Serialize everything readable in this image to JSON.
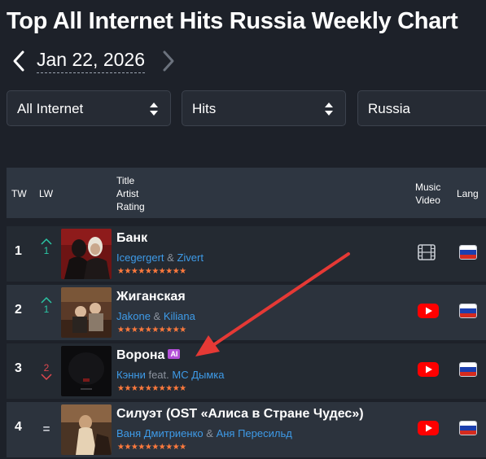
{
  "page": {
    "title": "Top All Internet Hits Russia Weekly Chart",
    "date": "Jan 22, 2026"
  },
  "filters": {
    "platform": "All Internet",
    "type": "Hits",
    "country": "Russia"
  },
  "table_header": {
    "tw": "TW",
    "lw": "LW",
    "title_lines": [
      "Title",
      "Artist",
      "Rating"
    ],
    "music_video_lines": [
      "Music",
      "Video"
    ],
    "lang": "Lang"
  },
  "rows": [
    {
      "rank": "1",
      "lw": "1",
      "lw_trend": "up",
      "title": "Банк",
      "ai_badge": "",
      "artists": [
        "Icegergert",
        "Zivert"
      ],
      "separator": "&",
      "stars": "★★★★★★★★★★",
      "video_icon": "film-icon",
      "lang_flag": "russia-flag-icon"
    },
    {
      "rank": "2",
      "lw": "1",
      "lw_trend": "up",
      "title": "Жиганская",
      "ai_badge": "",
      "artists": [
        "Jakone",
        "Kiliana"
      ],
      "separator": "&",
      "stars": "★★★★★★★★★★",
      "video_icon": "youtube-icon",
      "lang_flag": "russia-flag-icon"
    },
    {
      "rank": "3",
      "lw": "2",
      "lw_trend": "down",
      "title": "Ворона",
      "ai_badge": "AI",
      "artists": [
        "Кэнни",
        "МС Дымка"
      ],
      "separator": "feat.",
      "stars": "★★★★★★★★★★",
      "video_icon": "youtube-icon",
      "lang_flag": "russia-flag-icon"
    },
    {
      "rank": "4",
      "lw": "=",
      "lw_trend": "same",
      "title": "Силуэт (OST «Алиса в Стране Чудес»)",
      "ai_badge": "",
      "artists": [
        "Ваня Дмитриенко",
        "Аня Пересильд"
      ],
      "separator": "&",
      "stars": "★★★★★★★★★★",
      "video_icon": "youtube-icon",
      "lang_flag": "russia-flag-icon"
    }
  ],
  "colors": {
    "background": "#1d2129",
    "artist_link": "#3e9be8",
    "stars": "#ff7a3d",
    "trend_up": "#2bc6a5",
    "trend_down": "#e0484f",
    "ai_badge": "#b34fd8",
    "annotation_arrow": "#e53935",
    "youtube": "#ff0000"
  }
}
